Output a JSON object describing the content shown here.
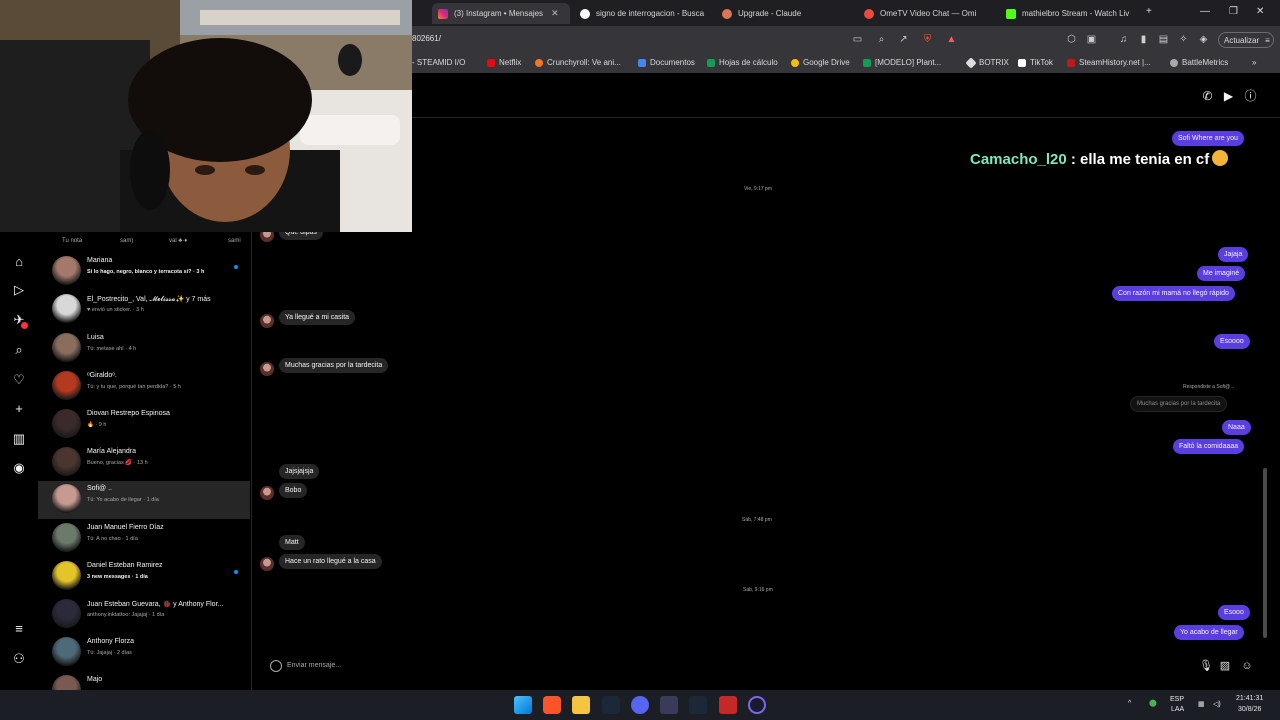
{
  "browser": {
    "tabs": [
      {
        "title": "(3) Instagram • Mensajes",
        "active": true
      },
      {
        "title": "signo de interrogacion - Busca",
        "active": false
      },
      {
        "title": "Upgrade - Claude",
        "active": false
      },
      {
        "title": "OmeTV Video Chat — Omi",
        "active": false
      },
      {
        "title": "mathielbro Stream - Watch Liv",
        "active": false
      }
    ],
    "new_tab": "+",
    "url": "802661/",
    "update_button": "Actualizar",
    "bookmarks": [
      {
        "label": "- STEAMID I/O",
        "color": "#3a3a3a"
      },
      {
        "label": "Netflix",
        "color": "#e50914"
      },
      {
        "label": "Crunchyroll: Ve ani...",
        "color": "#f47521"
      },
      {
        "label": "Documentos",
        "color": "#4285f4"
      },
      {
        "label": "Hojas de cálculo",
        "color": "#0f9d58"
      },
      {
        "label": "Google Drive",
        "color": "#fbbc04"
      },
      {
        "label": "[MODELO] Plant...",
        "color": "#0f9d58"
      },
      {
        "label": "BOTRIX",
        "color": "#dddddd"
      },
      {
        "label": "TikTok",
        "color": "#111111"
      },
      {
        "label": "SteamHistory.net |...",
        "color": "#c01818"
      },
      {
        "label": "BattleMetrics",
        "color": "#aaaaaa"
      }
    ],
    "more_bookmarks": "»"
  },
  "notes": [
    "Tu nota",
    "sam)",
    "val ♣·♦",
    "sami"
  ],
  "conversations": [
    {
      "name": "Mariana",
      "preview": "Si lo hago, negro, blanco y terracota sí? · 3 h",
      "bold": true,
      "unread": true,
      "avatar_color": "#a4786a"
    },
    {
      "name": "El_Postrecito_, Val, 𝓜𝓮𝓵𝓲𝓼𝓼𝓪✨ y 7 más",
      "preview": "♥ envió un sticker. · 3 h",
      "bold": false,
      "unread": false,
      "avatar_color": "#d8d8d8"
    },
    {
      "name": "Luisa",
      "preview": "Tú: metase ahí · 4 h",
      "bold": false,
      "unread": false,
      "avatar_color": "#8a6d5d"
    },
    {
      "name": "ᵒGiraldoᵒ.",
      "preview": "Tú: y tu que, porqué tan perdida? · 5 h",
      "bold": false,
      "unread": false,
      "avatar_color": "#b33a1f"
    },
    {
      "name": "Diovan Restrepo Espinosa",
      "preview": "🔥 · 9 h",
      "bold": false,
      "unread": false,
      "avatar_color": "#3b2a2a"
    },
    {
      "name": "María Alejandra",
      "preview": "Bueno, gracias 💋 · 13 h",
      "bold": false,
      "unread": false,
      "avatar_color": "#4a3530"
    },
    {
      "name": "Sofi@ ..",
      "preview": "Tú: Yo acabo de llegar · 1 día",
      "bold": false,
      "unread": false,
      "avatar_color": "#c69a90",
      "selected": true
    },
    {
      "name": "Juan Manuel Fierro Díaz",
      "preview": "Tú: A no chao · 1 día",
      "bold": false,
      "unread": false,
      "avatar_color": "#6b7a6b"
    },
    {
      "name": "Daniel Esteban Ramirez",
      "preview": "3 new messages · 1 día",
      "bold": true,
      "unread": true,
      "avatar_color": "#e3c52a"
    },
    {
      "name": "Juan Esteban Guevara, 🐞 y Anthony Flor...",
      "preview": "anthony.inktattoo: Jajajaj · 1 día",
      "bold": false,
      "unread": false,
      "avatar_color": "#2a2a3a"
    },
    {
      "name": "Anthony Florza",
      "preview": "Tú: Jajajaj · 2 días",
      "bold": false,
      "unread": false,
      "avatar_color": "#4d6a78"
    },
    {
      "name": "Majo",
      "preview": "",
      "bold": false,
      "unread": false,
      "avatar_color": "#7a5a50"
    }
  ],
  "chat": {
    "overlay": {
      "user": "Camacho_l20",
      "text": " : ella me tenia en cf"
    },
    "timestamps": [
      "Vie, 9:17 pm",
      "Sáb, 7:48 pm",
      "Sáb, 9:16 pm"
    ],
    "messages": [
      {
        "dir": "out",
        "text": "Sofi Where are you"
      },
      {
        "dir": "in",
        "text": "Qué dipas"
      },
      {
        "dir": "in",
        "text": "Ya llegué a mi casita"
      },
      {
        "dir": "in",
        "text": "Muchas gracias por la tardecita"
      },
      {
        "dir": "out",
        "text": "Jajaja"
      },
      {
        "dir": "out",
        "text": "Me imaginé"
      },
      {
        "dir": "out",
        "text": "Con razón mi mamá no llegó rápido"
      },
      {
        "dir": "out",
        "text": "Esoooo"
      },
      {
        "dir": "out",
        "text": "Naaa"
      },
      {
        "dir": "out",
        "text": "Faltó la comidaaaa"
      },
      {
        "dir": "in",
        "text": "Jajsjajsja"
      },
      {
        "dir": "in",
        "text": "Bobo"
      },
      {
        "dir": "in",
        "text": "Matt"
      },
      {
        "dir": "in",
        "text": "Hace un rato llegué a la casa"
      },
      {
        "dir": "out",
        "text": "Esooo"
      },
      {
        "dir": "out",
        "text": "Yo acabo de llegar"
      }
    ],
    "reply": {
      "label": "Respondiste a Sofi@ ..",
      "quote": "Muchas gracias por la tardecita"
    },
    "composer_placeholder": "Enviar mensaje..."
  },
  "taskbar": {
    "lang": "ESP",
    "region": "LAA",
    "time": "21:41:31",
    "date": "30/8/26",
    "tray_chevron": "^"
  },
  "colors": {
    "outgoing_bubble": "#5a3ee0",
    "incoming_bubble": "#262626",
    "overlay_username": "#7fe8bb"
  }
}
